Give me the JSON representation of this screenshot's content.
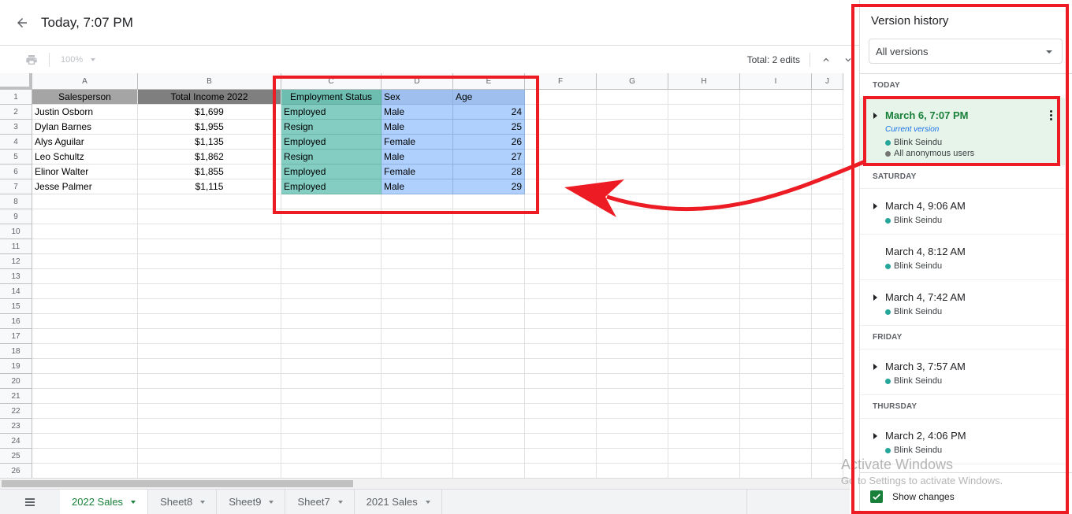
{
  "header": {
    "back_icon": "arrow-left-icon",
    "title": "Today, 7:07 PM"
  },
  "toolbar": {
    "print_icon": "print-icon",
    "zoom": "100%",
    "total_edits": "Total: 2 edits",
    "prev_icon": "chevron-up-icon",
    "next_icon": "chevron-down-icon"
  },
  "grid": {
    "columns": [
      "A",
      "B",
      "C",
      "D",
      "E",
      "F",
      "G",
      "H",
      "I",
      "J"
    ],
    "rows": [
      "1",
      "2",
      "3",
      "4",
      "5",
      "6",
      "7",
      "8",
      "9",
      "10",
      "11",
      "12",
      "13",
      "14",
      "15",
      "16",
      "17",
      "18",
      "19",
      "20",
      "21",
      "22",
      "23",
      "24",
      "25",
      "26"
    ],
    "headers": [
      "Salesperson",
      "Total Income 2022",
      "Employment Status",
      "Sex",
      "Age"
    ],
    "data": [
      [
        "Justin Osborn",
        "$1,699",
        "Employed",
        "Male",
        "24"
      ],
      [
        "Dylan Barnes",
        "$1,955",
        "Resign",
        "Male",
        "25"
      ],
      [
        "Alys Aguilar",
        "$1,135",
        "Employed",
        "Female",
        "26"
      ],
      [
        "Leo Schultz",
        "$1,862",
        "Resign",
        "Male",
        "27"
      ],
      [
        "Elinor Walter",
        "$1,855",
        "Employed",
        "Female",
        "28"
      ],
      [
        "Jesse Palmer",
        "$1,115",
        "Employed",
        "Male",
        "29"
      ]
    ]
  },
  "sheets": {
    "all_sheets_icon": "menu-list-icon",
    "tabs": [
      "2022 Sales",
      "Sheet8",
      "Sheet9",
      "Sheet7",
      "2021 Sales"
    ],
    "active": "2022 Sales"
  },
  "version_panel": {
    "title": "Version history",
    "filter": "All versions",
    "groups": [
      {
        "day": "TODAY",
        "items": [
          {
            "time": "March 6, 7:07 PM",
            "current_label": "Current version",
            "users": [
              {
                "name": "Blink Seindu",
                "color": "#26a69a"
              },
              {
                "name": "All anonymous users",
                "color": "#757575"
              }
            ],
            "expandable": true,
            "current": true
          }
        ]
      },
      {
        "day": "SATURDAY",
        "items": [
          {
            "time": "March 4, 9:06 AM",
            "users": [
              {
                "name": "Blink Seindu",
                "color": "#26a69a"
              }
            ],
            "expandable": true
          },
          {
            "time": "March 4, 8:12 AM",
            "users": [
              {
                "name": "Blink Seindu",
                "color": "#26a69a"
              }
            ],
            "expandable": false
          },
          {
            "time": "March 4, 7:42 AM",
            "users": [
              {
                "name": "Blink Seindu",
                "color": "#26a69a"
              }
            ],
            "expandable": true
          }
        ]
      },
      {
        "day": "FRIDAY",
        "items": [
          {
            "time": "March 3, 7:57 AM",
            "users": [
              {
                "name": "Blink Seindu",
                "color": "#26a69a"
              }
            ],
            "expandable": true
          }
        ]
      },
      {
        "day": "THURSDAY",
        "items": [
          {
            "time": "March 2, 4:06 PM",
            "users": [
              {
                "name": "Blink Seindu",
                "color": "#26a69a"
              }
            ],
            "expandable": true
          }
        ]
      }
    ],
    "show_changes_label": "Show changes",
    "show_changes_checked": true
  },
  "watermark": {
    "line1": "Activate Windows",
    "line2": "Go to Settings to activate Windows."
  },
  "colors": {
    "annotation": "#ed1c24",
    "accent_green": "#188038",
    "current_bg": "#e6f4ea"
  }
}
